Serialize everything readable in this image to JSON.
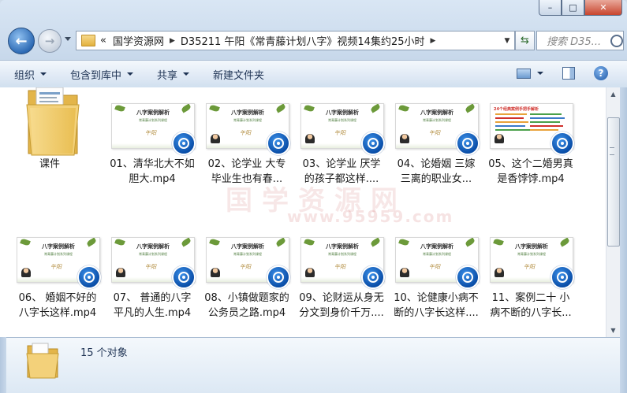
{
  "window": {
    "minimize": "–",
    "maximize": "□",
    "close": "✕"
  },
  "nav": {
    "back": "←",
    "forward": "→",
    "overflow": "«",
    "path": [
      "国学资源网",
      "D35211 午阳《常青藤计划八字》视频14集约25小时"
    ],
    "search_placeholder": "搜索 D35..."
  },
  "toolbar": {
    "organize": "组织",
    "include_library": "包含到库中",
    "share": "共享",
    "new_folder": "新建文件夹"
  },
  "items": [
    {
      "type": "folder",
      "label": "课件",
      "label2": ""
    },
    {
      "type": "video",
      "label": "01、清华北大不如",
      "label2": "胆大.mp4"
    },
    {
      "type": "video",
      "label": "02、论学业 大专",
      "label2": "毕业生也有春..."
    },
    {
      "type": "video",
      "label": "03、论学业 厌学",
      "label2": "的孩子都这样...."
    },
    {
      "type": "video",
      "label": "04、论婚姻 三嫁",
      "label2": "三离的职业女..."
    },
    {
      "type": "video",
      "label": "05、这个二婚男真",
      "label2": "是香饽饽.mp4",
      "thumb_title": "24个经典案例手把手解析"
    },
    {
      "type": "video",
      "label": "06、 婚姻不好的",
      "label2": "八字长这样.mp4"
    },
    {
      "type": "video",
      "label": "07、 普通的八字",
      "label2": "平凡的人生.mp4"
    },
    {
      "type": "video",
      "label": "08、小镇做题家的",
      "label2": "公务员之路.mp4"
    },
    {
      "type": "video",
      "label": "09、论财运从身无",
      "label2": "分文到身价千万...."
    },
    {
      "type": "video",
      "label": "10、论健康小病不",
      "label2": "断的八字长这样...."
    },
    {
      "type": "video",
      "label": "11、案例二十 小",
      "label2": "病不断的八字长..."
    }
  ],
  "thumb": {
    "title": "八字案例解析",
    "subtitle": "常青藤计划系列课程",
    "signature": "午阳"
  },
  "watermark": {
    "line1": "国学资源网",
    "line2": "www.95959.com"
  },
  "status": {
    "count": "15 个对象"
  }
}
